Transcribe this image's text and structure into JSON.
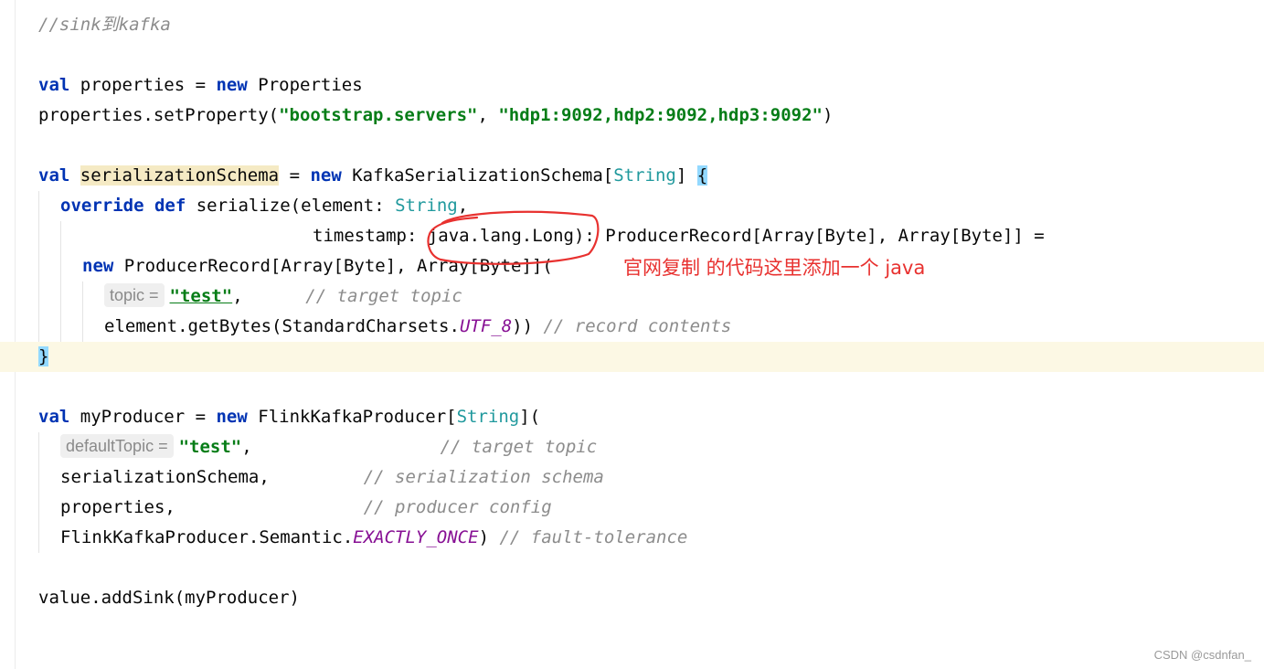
{
  "code": {
    "l1_comment": "//sink到kafka",
    "l2_kw_val": "val",
    "l2_rest": " properties = ",
    "l2_kw_new": "new",
    "l2_type": " Properties",
    "l3_pre": "properties.setProperty(",
    "l3_str1": "\"bootstrap.servers\"",
    "l3_sep": ", ",
    "l3_str2": "\"hdp1:9092,hdp2:9092,hdp3:9092\"",
    "l3_post": ")",
    "l4_kw_val": "val",
    "l4_sp": " ",
    "l4_var": "serializationSchema",
    "l4_eq": " = ",
    "l4_kw_new": "new",
    "l4_cls": " KafkaSerializationSchema[",
    "l4_type": "String",
    "l4_close": "] ",
    "l4_brace": "{",
    "l5_kw_override": "override",
    "l5_sp": " ",
    "l5_kw_def": "def",
    "l5_rest": " serialize(element: ",
    "l5_type": "String",
    "l5_comma": ",",
    "l6_rest": "timestamp: java.lang.Long): ProducerRecord[Array[Byte], Array[Byte]] =",
    "l7_kw_new": "new",
    "l7_rest": " ProducerRecord[Array[Byte], Array[Byte]](",
    "l8_hint": "topic =",
    "l8_str": "\"test\"",
    "l8_comma": ",      ",
    "l8_comment": "// target topic",
    "l9_pre": "element.getBytes(StandardCharsets.",
    "l9_const": "UTF_8",
    "l9_post": ")) ",
    "l9_comment": "// record contents",
    "l10_brace": "}",
    "l11_kw_val": "val",
    "l11_rest": " myProducer = ",
    "l11_kw_new": "new",
    "l11_cls": " FlinkKafkaProducer[",
    "l11_type": "String",
    "l11_close": "](",
    "l12_hint": "defaultTopic =",
    "l12_str": "\"test\"",
    "l12_comma": ",                  ",
    "l12_comment": "// target topic",
    "l13_text": "serializationSchema,         ",
    "l13_comment": "// serialization schema",
    "l14_text": "properties,                  ",
    "l14_comment": "// producer config",
    "l15_pre": "FlinkKafkaProducer.Semantic.",
    "l15_const": "EXACTLY_ONCE",
    "l15_post": ") ",
    "l15_comment": "// fault-tolerance",
    "l16_text": "value.addSink(myProducer)"
  },
  "annotation": {
    "text": "官网复制 的代码这里添加一个 java",
    "color": "#e8312f"
  },
  "watermark": "CSDN @csdnfan_"
}
